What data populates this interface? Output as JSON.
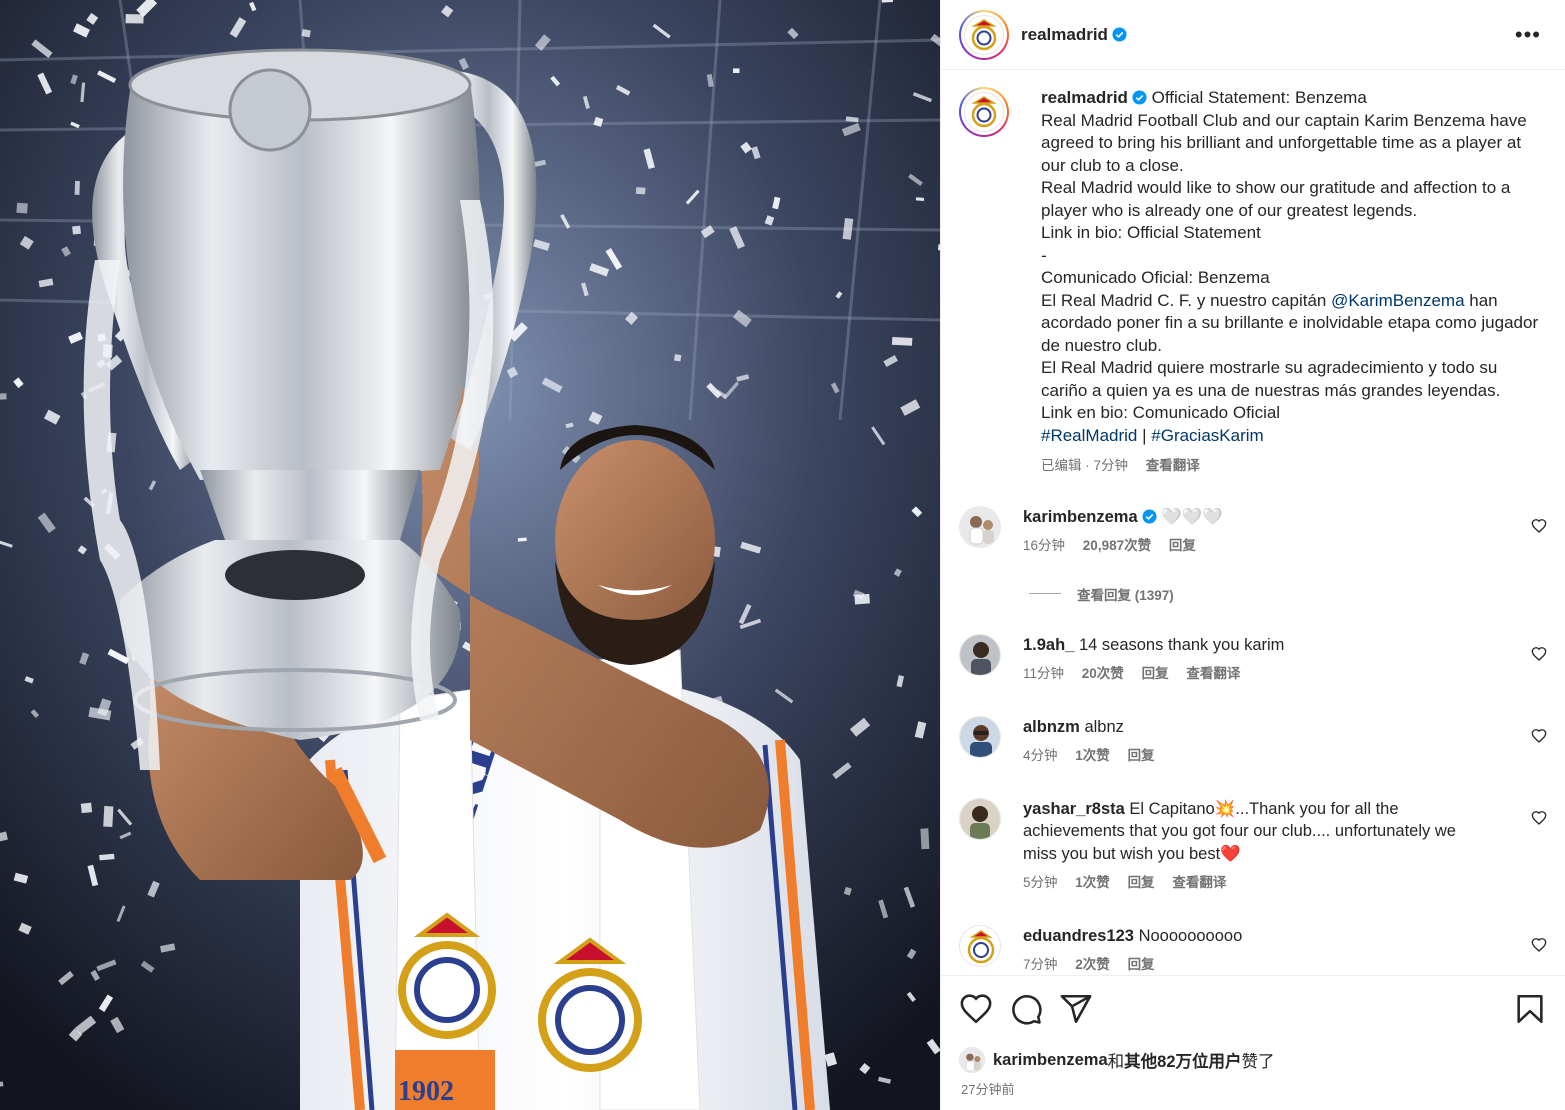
{
  "account": {
    "username": "realmadrid",
    "verified": true
  },
  "header": {
    "more_label": "•••"
  },
  "caption": {
    "username": "realmadrid",
    "lines": [
      "Official Statement: Benzema",
      "Real Madrid Football Club and our captain Karim Benzema have agreed to bring his brilliant and unforgettable time as a player at our club to a close.",
      "Real Madrid would like to show our gratitude and affection to a player who is already one of our greatest legends.",
      "Link in bio: Official Statement",
      "-",
      "Comunicado Oficial: Benzema"
    ],
    "es_line1_before": "El Real Madrid C. F. y nuestro capitán ",
    "es_mention": "@KarimBenzema",
    "es_line1_after": " han acordado poner fin a su brillante e inolvidable etapa como jugador de nuestro club.",
    "es_line2": "El Real Madrid quiere mostrarle su agradecimiento y todo su cariño a quien ya es una de nuestras más grandes leyendas.",
    "es_line3": "Link en bio: Comunicado Oficial",
    "hashtag1": "#RealMadrid",
    "hashtag_sep": " | ",
    "hashtag2": "#GraciasKarim",
    "edited": "已编辑 · 7分钟",
    "translate": "查看翻译"
  },
  "comments": [
    {
      "username": "karimbenzema",
      "verified": true,
      "text": "🤍🤍🤍",
      "time": "16分钟",
      "likes": "20,987次赞",
      "reply": "回复",
      "translate": ""
    },
    {
      "username": "1.9ah_",
      "verified": false,
      "text": "14 seasons thank you karim",
      "time": "11分钟",
      "likes": "20次赞",
      "reply": "回复",
      "translate": "查看翻译"
    },
    {
      "username": "albnzm",
      "verified": false,
      "text": "albnz",
      "time": "4分钟",
      "likes": "1次赞",
      "reply": "回复",
      "translate": ""
    },
    {
      "username": "yashar_r8sta",
      "verified": false,
      "text": "El Capitano💥...Thank you for all the achievements that you got four our club.... unfortunately we miss you but wish you best❤️",
      "time": "5分钟",
      "likes": "1次赞",
      "reply": "回复",
      "translate": "查看翻译"
    },
    {
      "username": "eduandres123",
      "verified": false,
      "text": "Noooooooooo",
      "time": "7分钟",
      "likes": "2次赞",
      "reply": "回复",
      "translate": ""
    }
  ],
  "view_replies": "查看回复 (1397)",
  "likes": {
    "user": "karimbenzema",
    "connector": "和",
    "others": "其他82万位用户",
    "suffix": "赞了"
  },
  "posted": "27分钟前",
  "colors": {
    "link": "#00376b",
    "verified": "#0095f6",
    "muted": "#737373",
    "heart_red": "#ed1c24"
  },
  "icons": [
    "verified-icon",
    "more-icon",
    "heart-icon",
    "comment-icon",
    "share-icon",
    "save-icon"
  ],
  "image": {
    "scarf_year": "1902",
    "shirt_text": "RE"
  }
}
